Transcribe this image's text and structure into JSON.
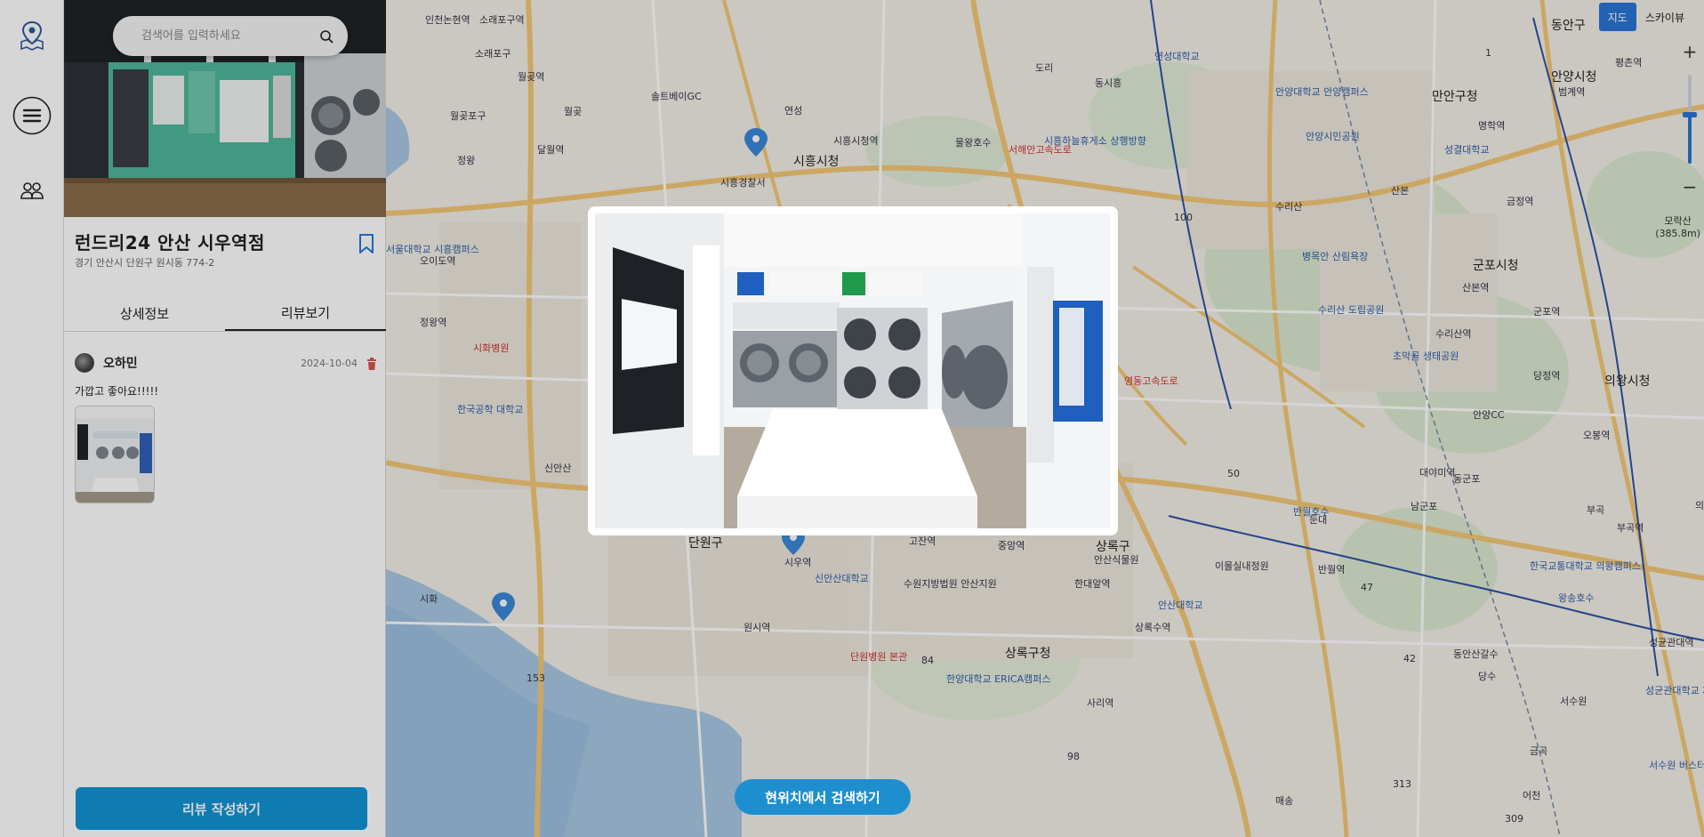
{
  "search": {
    "placeholder": "검색어를 입력하세요"
  },
  "store": {
    "name": "런드리24 안산 시우역점",
    "address": "경기 안산시 단원구 원시동 774-2"
  },
  "tabs": [
    {
      "label": "상세정보",
      "active": false
    },
    {
      "label": "리뷰보기",
      "active": true
    }
  ],
  "review": {
    "author": "오하민",
    "date": "2024-10-04",
    "text": "가깝고 좋아요!!!!!"
  },
  "buttons": {
    "write_review": "리뷰 작성하기",
    "search_here": "현위치에서 검색하기"
  },
  "map": {
    "type_options": [
      "지도",
      "스카이뷰"
    ],
    "selected_type": "지도",
    "scale_label": "모락산",
    "scale_value": "(385.8m)",
    "places": [
      "인천논현역",
      "소래포구역",
      "소래포구",
      "월곶역",
      "월곶포구",
      "월곶",
      "달월역",
      "정왕",
      "솔트베이GC",
      "연성",
      "시흥시청역",
      "시흥시청",
      "시흥경찰서",
      "도리",
      "동시흥",
      "물왕호수",
      "시흥하늘휴게소 상행방향",
      "연성대학교",
      "안양대학교 안양캠퍼스",
      "만안구청",
      "명학역",
      "안양시청",
      "범계역",
      "평촌역",
      "동안구",
      "성결대학교",
      "안양시민공원",
      "수리산",
      "산본",
      "금정역",
      "병목안 산림욕장",
      "수리산 도립공원",
      "군포시청",
      "산본역",
      "수리산역",
      "초막골 생태공원",
      "군포역",
      "당정역",
      "의왕시청",
      "안양CC",
      "오봉역",
      "대야미역",
      "동군포",
      "남군포",
      "반월호수",
      "둔대",
      "이몰실내정원",
      "반월역",
      "한국교통대학교 의왕캠퍼스",
      "오이도역",
      "정왕역",
      "시화병원",
      "한국공학 대학교",
      "서울대학교 시흥캠퍼스",
      "신안산",
      "단원구",
      "중앙역",
      "고잔역",
      "시우역",
      "신안산대학교",
      "수원지방법원 안산지원",
      "상록구",
      "안산식물원",
      "한대앞역",
      "상록수역",
      "안산대학교",
      "원시역",
      "시화",
      "단원병원 본관",
      "한양대학교 ERICA캠퍼스",
      "상록구청",
      "사리역",
      "의왕",
      "부곡",
      "부곡역",
      "왕송호수",
      "동안산갈수",
      "당수",
      "서수원",
      "성균관대역",
      "성균관대학교 자연과학캠퍼스",
      "서수원 버스터미널",
      "금곡",
      "어천",
      "매송",
      "영동고속도로",
      "서해안고속도로"
    ],
    "route_numbers": [
      "100",
      "50",
      "47",
      "42",
      "153",
      "84",
      "98",
      "313",
      "309",
      "1"
    ]
  }
}
